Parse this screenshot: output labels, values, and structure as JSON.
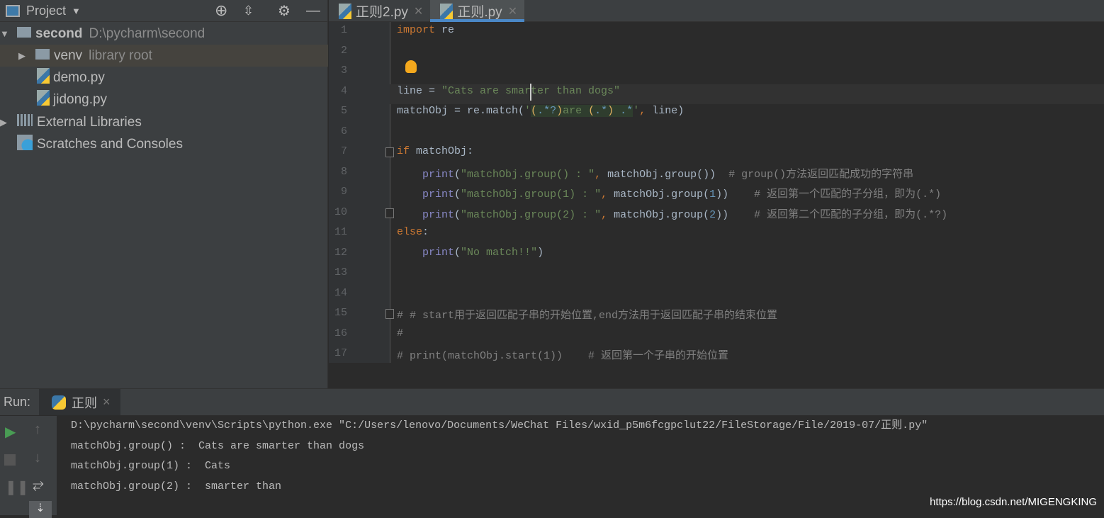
{
  "sidebar": {
    "title": "Project",
    "tree": [
      {
        "name": "second",
        "extra": "D:\\pycharm\\second",
        "icon": "folder-icon",
        "arrow": "▼",
        "indent": 0,
        "bold": true
      },
      {
        "name": "venv",
        "extra": "library root",
        "icon": "folder-icon",
        "arrow": "▶",
        "indent": 1,
        "selected": true
      },
      {
        "name": "demo.py",
        "extra": "",
        "icon": "python-file-icon",
        "arrow": "",
        "indent": 2
      },
      {
        "name": "jidong.py",
        "extra": "",
        "icon": "python-file-icon",
        "arrow": "",
        "indent": 2
      },
      {
        "name": "External Libraries",
        "extra": "",
        "icon": "libraries-icon",
        "arrow": "▶",
        "indent": 0
      },
      {
        "name": "Scratches and Consoles",
        "extra": "",
        "icon": "scratches-icon",
        "arrow": "",
        "indent": 0
      }
    ]
  },
  "tabs": [
    {
      "label": "正则2.py",
      "active": false
    },
    {
      "label": "正则.py",
      "active": true
    }
  ],
  "editor": {
    "current_line": 4,
    "lines": [
      [
        [
          "k",
          "import"
        ],
        [
          "r",
          " re"
        ]
      ],
      [],
      [],
      [
        [
          "r",
          "line = "
        ],
        [
          "s",
          "\"Cats are smarter than dogs\""
        ]
      ],
      [
        [
          "r",
          "matchObj = re.match("
        ],
        [
          "s",
          "'"
        ],
        [
          "rp hl",
          "("
        ],
        [
          "rx hl",
          ".*?"
        ],
        [
          "rp hl",
          ")"
        ],
        [
          "s hl",
          "are "
        ],
        [
          "rp hl",
          "("
        ],
        [
          "rx hl",
          ".*"
        ],
        [
          "rp hl",
          ")"
        ],
        [
          "s hl",
          " "
        ],
        [
          "rx hl",
          ".*"
        ],
        [
          "s",
          "'"
        ],
        [
          "k",
          ","
        ],
        [
          "r",
          " line)"
        ]
      ],
      [],
      [
        [
          "k",
          "if"
        ],
        [
          "r",
          " matchObj:"
        ]
      ],
      [
        [
          "r",
          "    "
        ],
        [
          "f",
          "print"
        ],
        [
          "r",
          "("
        ],
        [
          "s",
          "\"matchObj.group() : \""
        ],
        [
          "k",
          ","
        ],
        [
          "r",
          " matchObj.group())  "
        ],
        [
          "c",
          "# group()方法返回匹配成功的字符串"
        ]
      ],
      [
        [
          "r",
          "    "
        ],
        [
          "f",
          "print"
        ],
        [
          "r",
          "("
        ],
        [
          "s",
          "\"matchObj.group(1) : \""
        ],
        [
          "k",
          ","
        ],
        [
          "r",
          " matchObj.group("
        ],
        [
          "n",
          "1"
        ],
        [
          "r",
          "))    "
        ],
        [
          "c",
          "# 返回第一个匹配的子分组，即为(.*)"
        ]
      ],
      [
        [
          "r",
          "    "
        ],
        [
          "f",
          "print"
        ],
        [
          "r",
          "("
        ],
        [
          "s",
          "\"matchObj.group(2) : \""
        ],
        [
          "k",
          ","
        ],
        [
          "r",
          " matchObj.group("
        ],
        [
          "n",
          "2"
        ],
        [
          "r",
          "))    "
        ],
        [
          "c",
          "# 返回第二个匹配的子分组，即为(.*?)"
        ]
      ],
      [
        [
          "k",
          "else"
        ],
        [
          "r",
          ":"
        ]
      ],
      [
        [
          "r",
          "    "
        ],
        [
          "f",
          "print"
        ],
        [
          "r",
          "("
        ],
        [
          "s",
          "\"No match!!\""
        ],
        [
          "r",
          ")"
        ]
      ],
      [],
      [],
      [
        [
          "c",
          "# # start用于返回匹配子串的开始位置,end方法用于返回匹配子串的结束位置"
        ]
      ],
      [
        [
          "c",
          "#"
        ]
      ],
      [
        [
          "c",
          "# print(matchObj.start(1))    # 返回第一个子串的开始位置"
        ]
      ]
    ]
  },
  "run": {
    "label": "Run:",
    "tab": "正则",
    "output": [
      "D:\\pycharm\\second\\venv\\Scripts\\python.exe \"C:/Users/lenovo/Documents/WeChat Files/wxid_p5m6fcgpclut22/FileStorage/File/2019-07/正则.py\"",
      "matchObj.group() :  Cats are smarter than dogs",
      "matchObj.group(1) :  Cats",
      "matchObj.group(2) :  smarter than"
    ]
  },
  "watermark": "https://blog.csdn.net/MIGENGKING",
  "colors": {
    "keyword": "#cc7832",
    "string": "#6a8759",
    "comment": "#808080",
    "accent": "#4a88c7",
    "run": "#499c54"
  }
}
